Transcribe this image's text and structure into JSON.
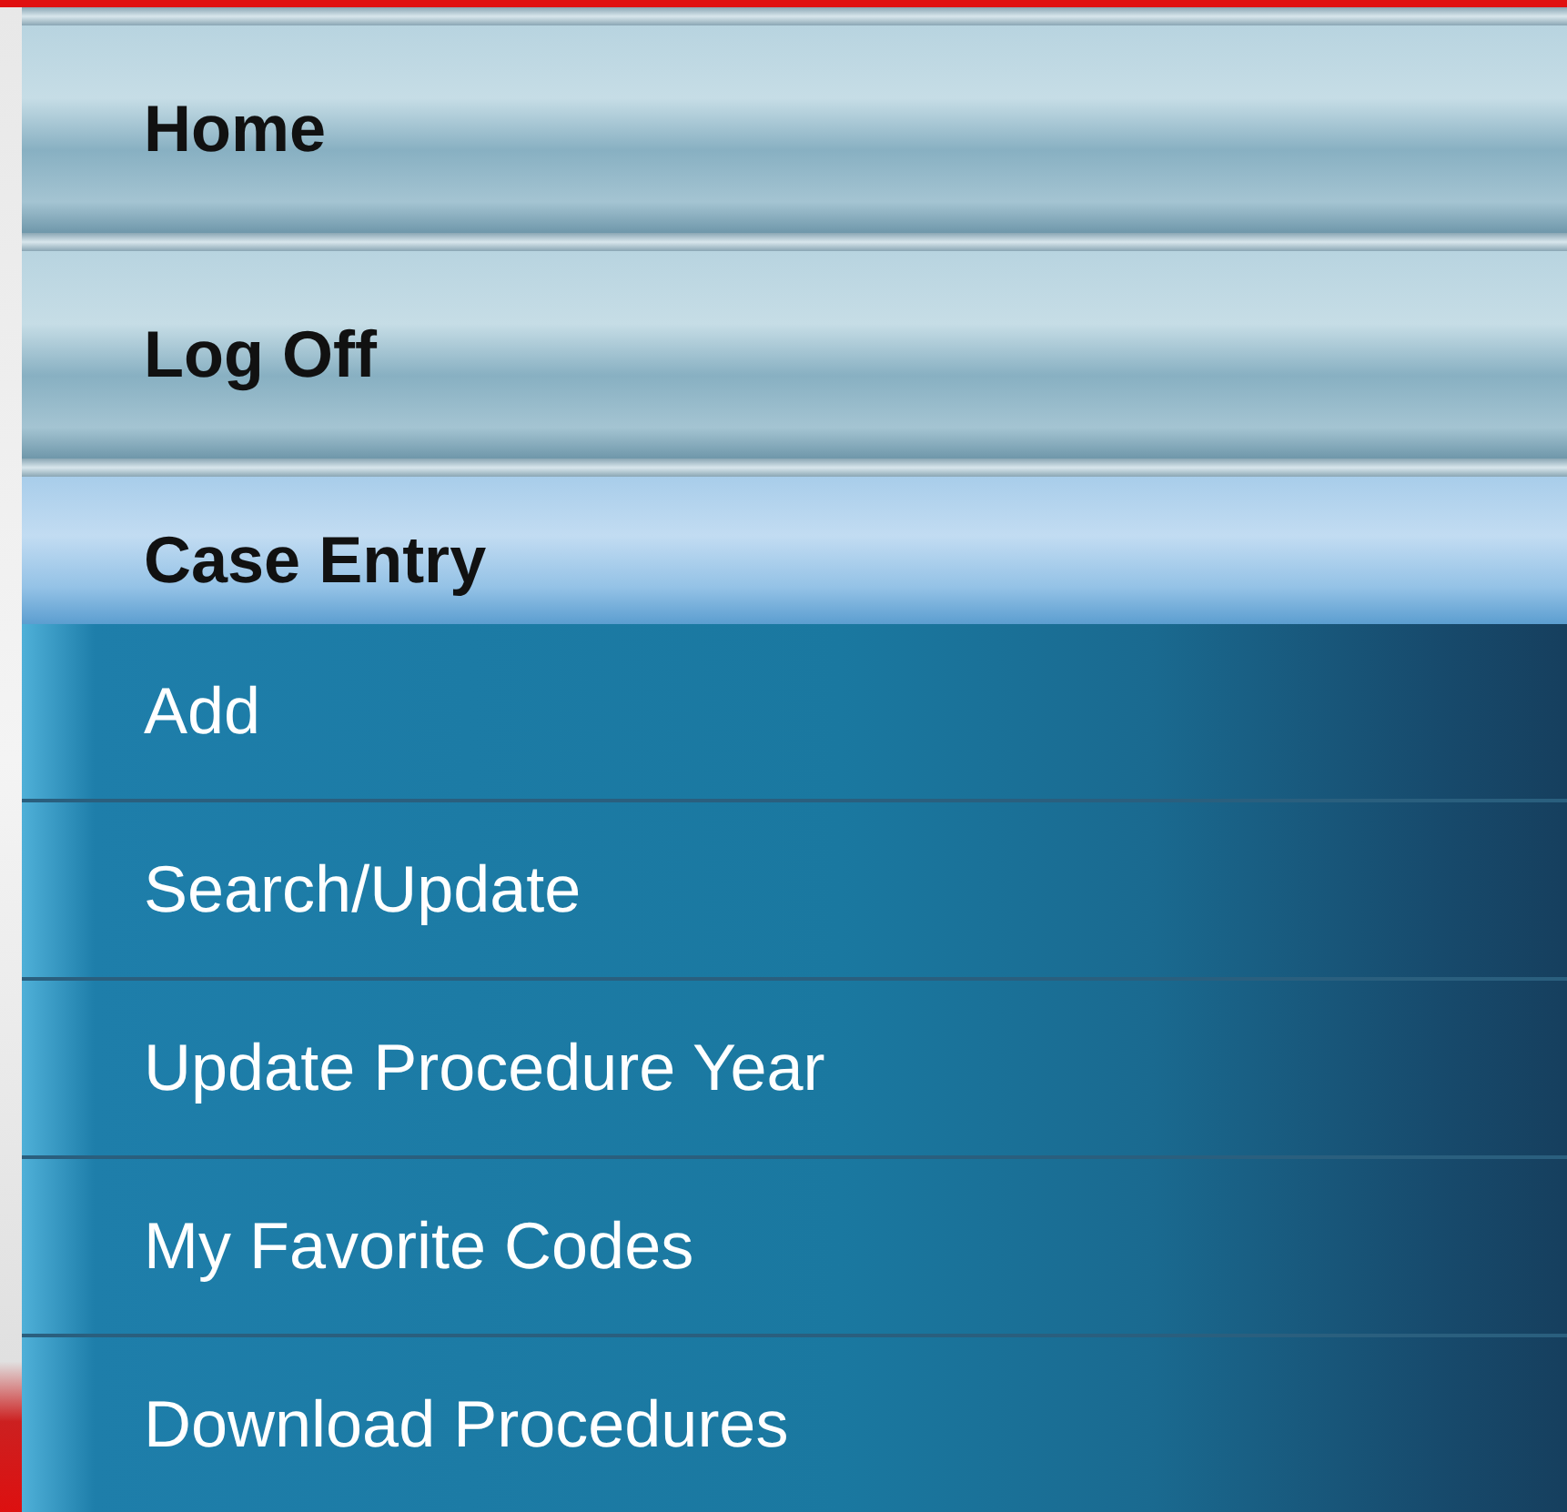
{
  "menu": [
    {
      "label": "Home",
      "kind": "link"
    },
    {
      "label": "Log Off",
      "kind": "link"
    }
  ],
  "section": {
    "title": "Case Entry",
    "expanded": true,
    "items": [
      {
        "label": "Add"
      },
      {
        "label": "Search/Update"
      },
      {
        "label": "Update Procedure Year"
      },
      {
        "label": "My Favorite Codes"
      },
      {
        "label": "Download Procedures"
      }
    ]
  }
}
